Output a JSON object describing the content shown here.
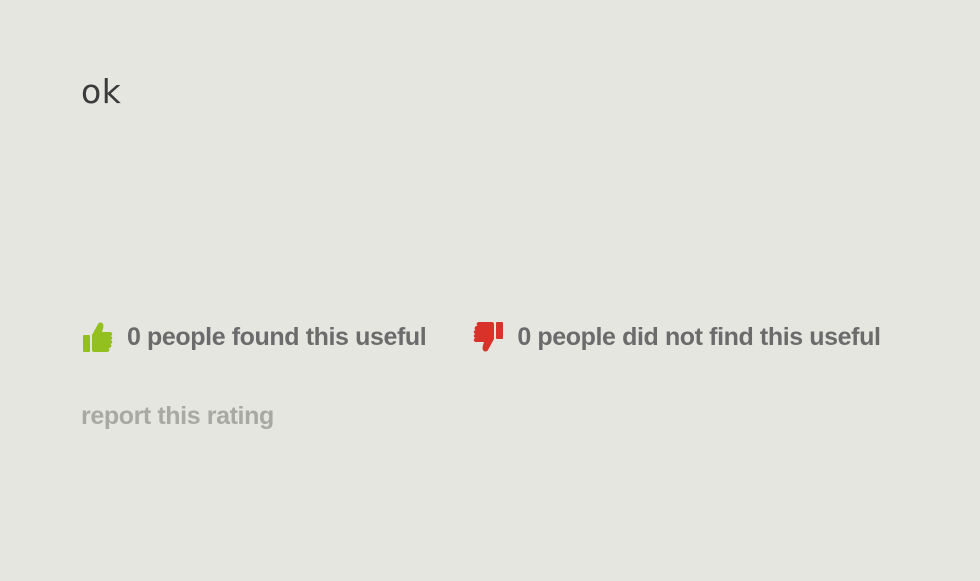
{
  "review": {
    "text": "ok"
  },
  "votes": {
    "useful": {
      "label": "0 people found this useful",
      "icon": "thumbs-up-icon",
      "color": "#93c01f"
    },
    "not_useful": {
      "label": "0 people did not find this useful",
      "icon": "thumbs-down-icon",
      "color": "#d8322a"
    }
  },
  "report": {
    "label": "report this rating"
  },
  "colors": {
    "background": "#e6e6e1",
    "text": "#3b3b3b",
    "vote_text": "#6b6b6b",
    "report_text": "#a8a8a4"
  }
}
